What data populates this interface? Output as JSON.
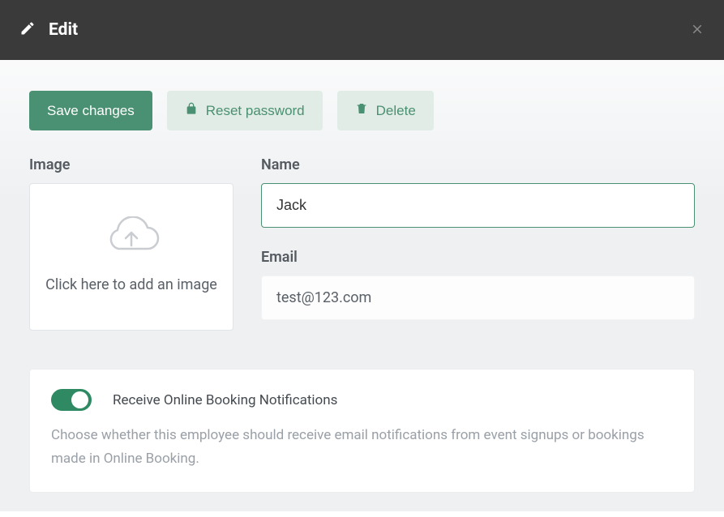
{
  "header": {
    "title": "Edit"
  },
  "toolbar": {
    "save_label": "Save changes",
    "reset_label": "Reset password",
    "delete_label": "Delete"
  },
  "form": {
    "image_label": "Image",
    "image_upload_text": "Click here to add an image",
    "name_label": "Name",
    "name_value": "Jack",
    "email_label": "Email",
    "email_value": "test@123.com"
  },
  "notifications": {
    "toggle_label": "Receive Online Booking Notifications",
    "toggle_desc": "Choose whether this employee should receive email notifications from event signups or bookings made in Online Booking.",
    "toggle_on": true
  }
}
